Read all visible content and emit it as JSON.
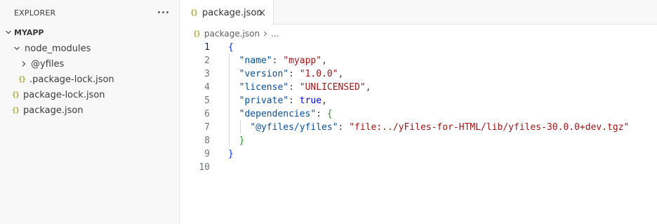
{
  "explorer": {
    "title": "EXPLORER",
    "root": "MYAPP",
    "items": [
      {
        "label": "node_modules",
        "type": "folder-open"
      },
      {
        "label": "@yfiles",
        "type": "folder-closed"
      },
      {
        "label": ".package-lock.json",
        "type": "json"
      },
      {
        "label": "package-lock.json",
        "type": "json"
      },
      {
        "label": "package.json",
        "type": "json"
      }
    ]
  },
  "tab": {
    "label": "package.json"
  },
  "breadcrumb": {
    "file": "package.json",
    "more": "..."
  },
  "editor": {
    "line_numbers": [
      "1",
      "2",
      "3",
      "4",
      "5",
      "6",
      "7",
      "8",
      "9",
      "10"
    ],
    "active_line": "1",
    "code": {
      "open_brace": "{",
      "k_name": "\"name\"",
      "v_name": "\"myapp\"",
      "k_version": "\"version\"",
      "v_version": "\"1.0.0\"",
      "k_license": "\"license\"",
      "v_license": "\"UNLICENSED\"",
      "k_private": "\"private\"",
      "v_private": "true",
      "k_dependencies": "\"dependencies\"",
      "k_yfiles": "\"@yfiles/yfiles\"",
      "v_yfiles": "\"file:../yFiles-for-HTML/lib/yfiles-30.0.0+dev.tgz\"",
      "close_inner": "}",
      "close_brace": "}"
    }
  },
  "colors": {
    "key": "#0451a5",
    "string": "#a31515",
    "keyword": "#0000ff",
    "json_icon": "#a8a831"
  }
}
